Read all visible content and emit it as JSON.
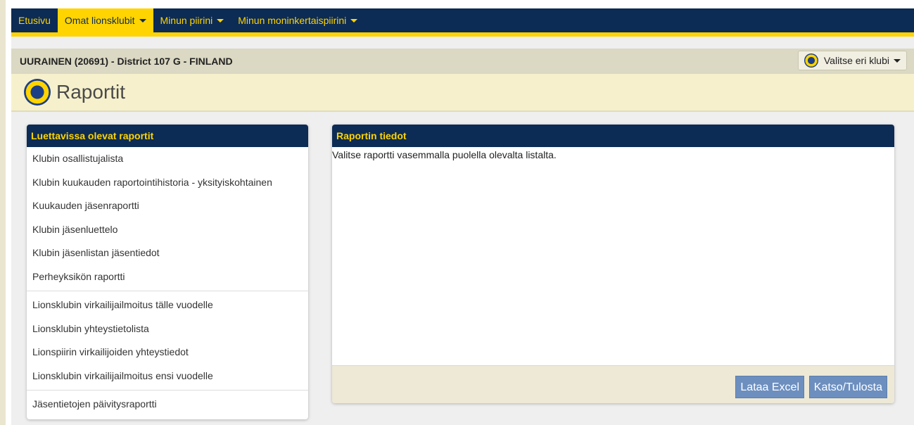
{
  "nav": {
    "items": [
      {
        "label": "Etusivu",
        "dropdown": false,
        "active": false
      },
      {
        "label": "Omat lionsklubit",
        "dropdown": true,
        "active": true
      },
      {
        "label": "Minun piirini",
        "dropdown": true,
        "active": false
      },
      {
        "label": "Minun moninkertaispiirini",
        "dropdown": true,
        "active": false
      }
    ]
  },
  "club": {
    "title": "UURAINEN (20691) - District 107 G - FINLAND",
    "select_label": "Valitse eri klubi"
  },
  "page": {
    "title": "Raportit"
  },
  "reports": {
    "header": "Luettavissa olevat raportit",
    "group1": [
      "Klubin osallistujalista",
      "Klubin kuukauden raportointihistoria - yksityiskohtainen",
      "Kuukauden jäsenraportti",
      "Klubin jäsenluettelo",
      "Klubin jäsenlistan jäsentiedot",
      "Perheyksikön raportti"
    ],
    "group2": [
      "Lionsklubin virkailijailmoitus tälle vuodelle",
      "Lionsklubin yhteystietolista",
      "Lionspiirin virkailijoiden yhteystiedot",
      "Lionsklubin virkailijailmoitus ensi vuodelle"
    ],
    "group3": [
      "Jäsentietojen päivitysraportti"
    ]
  },
  "details": {
    "header": "Raportin tiedot",
    "text": "Valitse raportti vasemmalla puolella olevalta listalta.",
    "excel_button": "Lataa Excel",
    "print_button": "Katso/Tulosta"
  },
  "colors": {
    "navy": "#0c2b55",
    "gold": "#ffd400",
    "button": "#6d8fbf"
  },
  "icons": [
    "lions-logo-icon",
    "caret-down-icon"
  ]
}
